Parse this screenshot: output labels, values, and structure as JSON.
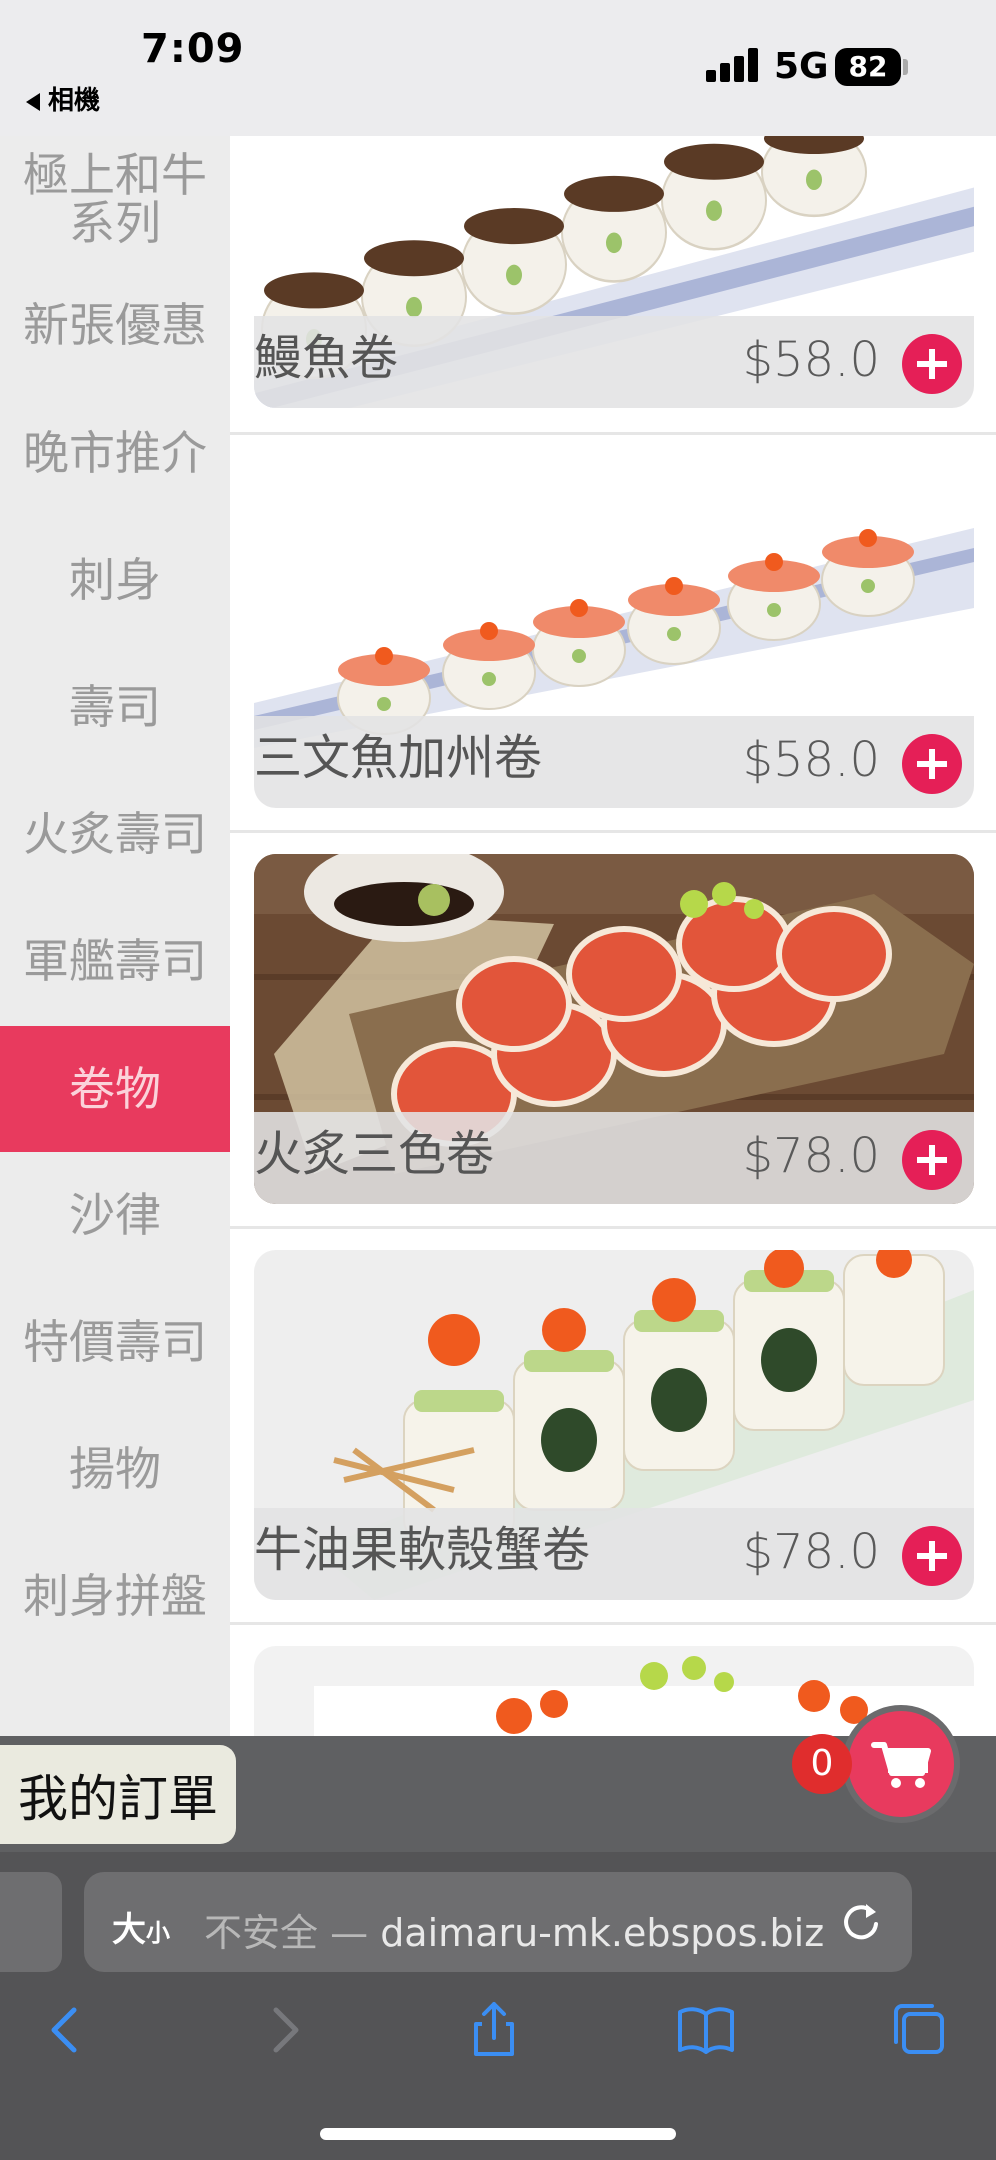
{
  "status_bar": {
    "time": "7:09",
    "back_app": "相機",
    "network": "5G",
    "battery": "82"
  },
  "sidebar": {
    "items": [
      {
        "label": "極上和牛系列",
        "active": false
      },
      {
        "label": "新張優惠",
        "active": false
      },
      {
        "label": "晚市推介",
        "active": false
      },
      {
        "label": "刺身",
        "active": false
      },
      {
        "label": "壽司",
        "active": false
      },
      {
        "label": "火炙壽司",
        "active": false
      },
      {
        "label": "軍艦壽司",
        "active": false
      },
      {
        "label": "卷物",
        "active": true
      },
      {
        "label": "沙律",
        "active": false
      },
      {
        "label": "特價壽司",
        "active": false
      },
      {
        "label": "揚物",
        "active": false
      },
      {
        "label": "刺身拼盤",
        "active": false
      }
    ]
  },
  "menu": {
    "items": [
      {
        "name": "鰻魚卷",
        "price": "$58.0",
        "image": "unagi-roll-photo"
      },
      {
        "name": "三文魚加州卷",
        "price": "$58.0",
        "image": "salmon-california-roll-photo"
      },
      {
        "name": "火炙三色卷",
        "price": "$78.0",
        "image": "aburi-three-color-roll-photo"
      },
      {
        "name": "牛油果軟殼蟹卷",
        "price": "$78.0",
        "image": "avocado-soft-shell-crab-roll-photo"
      },
      {
        "name": "",
        "price": "",
        "image": "partial-roll-photo"
      }
    ]
  },
  "order_bar": {
    "my_order_label": "我的訂單",
    "cart_count": "0"
  },
  "browser": {
    "text_size_label": "大",
    "text_size_small": "小",
    "security_label": "不安全 —",
    "url": "daimaru-mk.ebspos.biz"
  },
  "colors": {
    "accent": "#e83a5e",
    "add_button": "#e51f57",
    "sidebar_bg": "#ececec",
    "browser_bg": "#545456"
  }
}
